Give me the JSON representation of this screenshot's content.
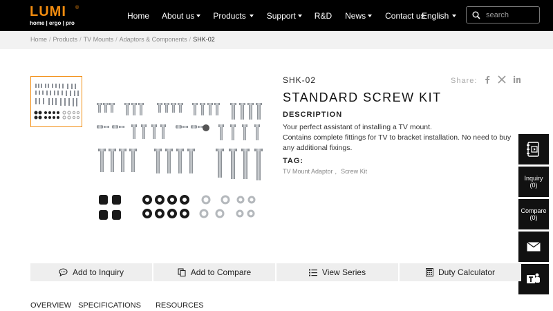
{
  "header": {
    "logo": {
      "main": "LUMI",
      "reg": "®",
      "sub": "home | ergo | pro"
    },
    "nav": [
      {
        "label": "Home",
        "dropdown": false
      },
      {
        "label": "About us",
        "dropdown": true
      },
      {
        "label": "Products",
        "dropdown": true
      },
      {
        "label": "Support",
        "dropdown": true
      },
      {
        "label": "R&D",
        "dropdown": false
      },
      {
        "label": "News",
        "dropdown": true
      },
      {
        "label": "Contact us",
        "dropdown": false
      }
    ],
    "language": "English",
    "search": {
      "placeholder": "search",
      "icon": "search-icon"
    }
  },
  "breadcrumb": [
    "Home",
    "Products",
    "TV Mounts",
    "Adaptors & Components",
    "SHK-02"
  ],
  "product": {
    "sku": "SHK-02",
    "title": "STANDARD SCREW KIT",
    "description_heading": "DESCRIPTION",
    "description_lines": [
      "Your perfect assistant of installing a TV mount.",
      "Contains complete fittings for TV to bracket installation. No need to buy any additional fixings."
    ],
    "tag_heading": "TAG:",
    "tags": [
      "TV Mount Adaptor",
      "Screw Kit"
    ],
    "share_label": "Share:",
    "share_icons": [
      "facebook-icon",
      "x-icon",
      "linkedin-icon"
    ]
  },
  "side_bar": {
    "catalog_icon": "catalog-icon",
    "inquiry": {
      "label": "Inquiry",
      "count": "(0)"
    },
    "compare": {
      "label": "Compare",
      "count": "(0)"
    },
    "mail_icon": "mail-icon",
    "teams_icon": "teams-icon"
  },
  "actions": [
    {
      "label": "Add to Inquiry",
      "icon": "chat-icon"
    },
    {
      "label": "Add to Compare",
      "icon": "compare-icon"
    },
    {
      "label": "View Series",
      "icon": "list-icon"
    },
    {
      "label": "Duty Calculator",
      "icon": "calculator-icon"
    }
  ],
  "tabs": [
    "OVERVIEW",
    "SPECIFICATIONS",
    "RESOURCES"
  ],
  "colors": {
    "brand": "#f28c0f",
    "header_bg": "#000000",
    "button_bg": "#eeeeee"
  }
}
